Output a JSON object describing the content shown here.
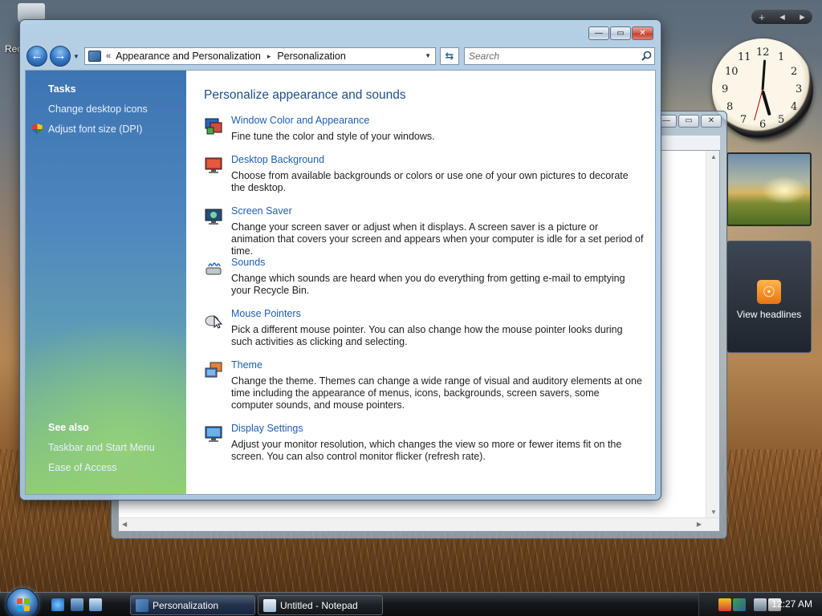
{
  "desktop": {
    "recycle_label": "Rec"
  },
  "gadgets": {
    "controls": [
      "+",
      "◂",
      "▸"
    ],
    "clock_numbers": [
      "12",
      "1",
      "2",
      "3",
      "4",
      "5",
      "6",
      "7",
      "8",
      "9",
      "10",
      "11"
    ],
    "feed_label": "View headlines"
  },
  "window": {
    "title": "Personalization",
    "caption_buttons": {
      "minimize": "—",
      "maximize": "▭",
      "close": "✕"
    },
    "address": {
      "overflow": "«",
      "crumbs": [
        "Appearance and Personalization",
        "Personalization"
      ],
      "separator": "▸"
    },
    "search_placeholder": "Search"
  },
  "tasks": {
    "heading": "Tasks",
    "links": [
      "Change desktop icons",
      "Adjust font size (DPI)"
    ],
    "see_also_heading": "See also",
    "see_also": [
      "Taskbar and Start Menu",
      "Ease of Access"
    ]
  },
  "main": {
    "title": "Personalize appearance and sounds",
    "items": [
      {
        "title": "Window Color and Appearance",
        "desc": "Fine tune the color and style of your windows.",
        "icon": "window-color-icon"
      },
      {
        "title": "Desktop Background",
        "desc": "Choose from available backgrounds or colors or use one of your own pictures to decorate the desktop.",
        "icon": "desktop-background-icon"
      },
      {
        "title": "Screen Saver",
        "desc": "Change your screen saver or adjust when it displays. A screen saver is a picture or animation that covers your screen and appears when your computer is idle for a set period of time.",
        "icon": "screen-saver-icon"
      },
      {
        "title": "Sounds",
        "desc": "Change which sounds are heard when you do everything from getting e-mail to emptying your Recycle Bin.",
        "icon": "sounds-icon"
      },
      {
        "title": "Mouse Pointers",
        "desc": "Pick a different mouse pointer. You can also change how the mouse pointer looks during such activities as clicking and selecting.",
        "icon": "mouse-pointer-icon"
      },
      {
        "title": "Theme",
        "desc": "Change the theme. Themes can change a wide range of visual and auditory elements at one time including the appearance of menus, icons, backgrounds, screen savers, some computer sounds, and mouse pointers.",
        "icon": "theme-icon"
      },
      {
        "title": "Display Settings",
        "desc": "Adjust your monitor resolution, which changes the view so more or fewer items fit on the screen. You can also control monitor flicker (refresh rate).",
        "icon": "display-settings-icon"
      }
    ]
  },
  "taskbar": {
    "buttons": [
      "Personalization",
      "Untitled - Notepad"
    ],
    "clock": "12:27 AM"
  },
  "colors": {
    "link": "#1d5fb4",
    "heading": "#1d4f8a",
    "taskpane_top": "#3d74b2",
    "taskpane_bottom": "#8fcb73"
  }
}
